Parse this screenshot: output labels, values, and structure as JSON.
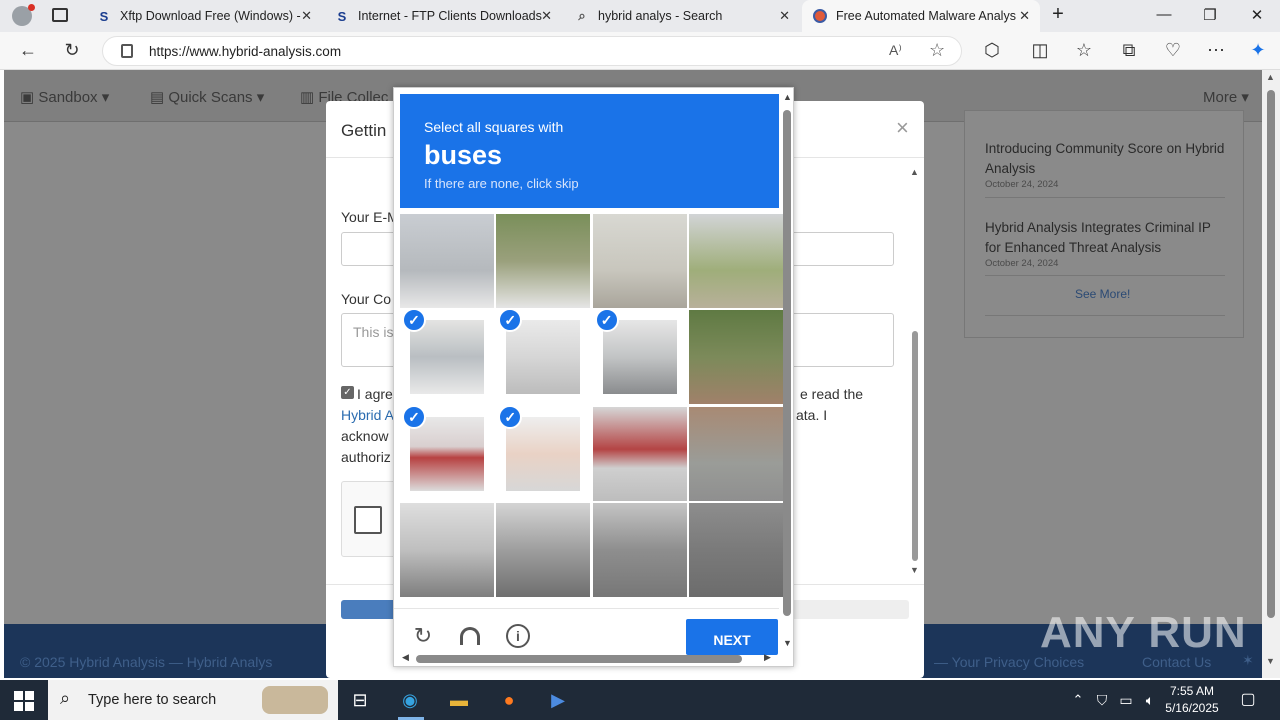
{
  "browser": {
    "tabs": [
      {
        "title": "Xftp Download Free (Windows) -",
        "icon": "s-brand-icon"
      },
      {
        "title": "Internet - FTP Clients Downloads",
        "icon": "s-brand-icon"
      },
      {
        "title": "hybrid analys - Search",
        "icon": "search-icon"
      },
      {
        "title": "Free Automated Malware Analysi",
        "icon": "hybrid-analysis-icon",
        "active": true
      }
    ],
    "url": "https://www.hybrid-analysis.com"
  },
  "site": {
    "nav": [
      "Sandbox",
      "Quick Scans",
      "File Collec",
      "More"
    ],
    "footer_left": "© 2025 Hybrid Analysis — Hybrid Analys",
    "footer_right": "— Your Privacy Choices",
    "footer_contact": "Contact Us",
    "news": [
      {
        "title": "Introducing Community Score on Hybrid Analysis",
        "date": "October 24, 2024"
      },
      {
        "title": "Hybrid Analysis Integrates Criminal IP for Enhanced Threat Analysis",
        "date": "October 24, 2024"
      }
    ],
    "see_more": "See More!"
  },
  "modal": {
    "title": "Gettin",
    "email_label": "Your E-M",
    "comment_label": "Your Co",
    "comment_placeholder": "This is",
    "agree_line1": "I agre",
    "agree_line1_right": "e read the",
    "agree_link": "Hybrid A",
    "agree_line2_right": "ata. I",
    "agree_line3": "acknow",
    "agree_line4": "authoriz",
    "close": "×"
  },
  "captcha": {
    "instruction": "Select all squares with",
    "target": "buses",
    "skip_hint": "If there are none, click skip",
    "next_label": "NEXT",
    "selected_tiles": [
      4,
      5,
      6,
      8,
      9
    ],
    "colors": {
      "accent": "#1a73e8"
    }
  },
  "taskbar": {
    "search_placeholder": "Type here to search",
    "time": "7:55 AM",
    "date": "5/16/2025"
  },
  "watermark": "ANY RUN"
}
